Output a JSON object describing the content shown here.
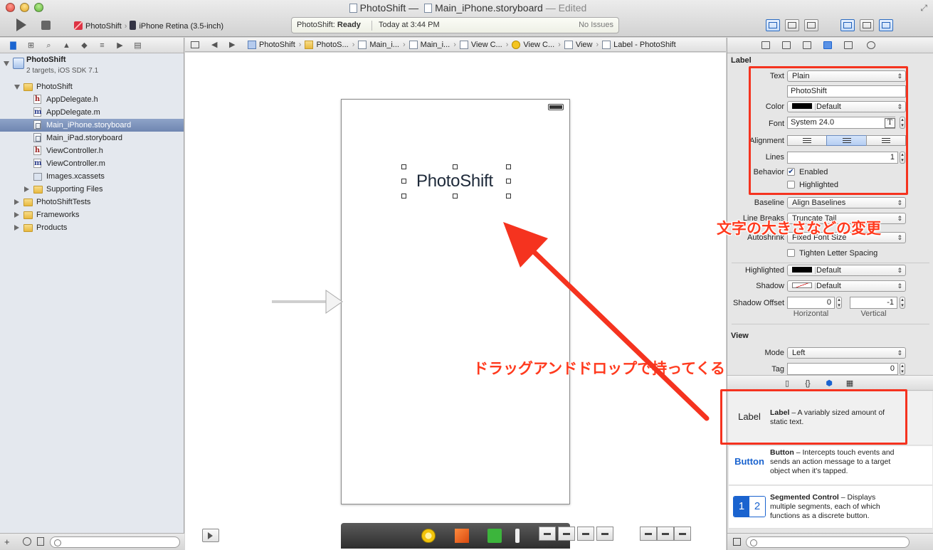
{
  "window": {
    "title": "PhotoShift",
    "doc_title": "Main_iPhone.storyboard",
    "edited": "— Edited",
    "separator": "—"
  },
  "toolbar": {
    "scheme": "PhotoShift",
    "device": "iPhone Retina (3.5-inch)",
    "status_app": "PhotoShift:",
    "status_state": "Ready",
    "status_time": "Today at 3:44 PM",
    "status_issues": "No Issues"
  },
  "navigator": {
    "project_name": "PhotoShift",
    "project_sub": "2 targets, iOS SDK 7.1",
    "items": [
      {
        "label": "PhotoShift",
        "type": "folder",
        "indent": 1,
        "disclosure": "open"
      },
      {
        "label": "AppDelegate.h",
        "type": "h",
        "indent": 2
      },
      {
        "label": "AppDelegate.m",
        "type": "m",
        "indent": 2
      },
      {
        "label": "Main_iPhone.storyboard",
        "type": "sb",
        "indent": 2,
        "selected": true
      },
      {
        "label": "Main_iPad.storyboard",
        "type": "sb",
        "indent": 2
      },
      {
        "label": "ViewController.h",
        "type": "h",
        "indent": 2
      },
      {
        "label": "ViewController.m",
        "type": "m",
        "indent": 2
      },
      {
        "label": "Images.xcassets",
        "type": "xc",
        "indent": 2
      },
      {
        "label": "Supporting Files",
        "type": "folder",
        "indent": 2,
        "disclosure": "closed"
      },
      {
        "label": "PhotoShiftTests",
        "type": "folder",
        "indent": 1,
        "disclosure": "closed"
      },
      {
        "label": "Frameworks",
        "type": "folder",
        "indent": 1,
        "disclosure": "closed"
      },
      {
        "label": "Products",
        "type": "folder",
        "indent": 1,
        "disclosure": "closed"
      }
    ]
  },
  "jumpbar": {
    "crumbs": [
      {
        "label": "PhotoShift",
        "icon": "proj"
      },
      {
        "label": "PhotoS...",
        "icon": "fold"
      },
      {
        "label": "Main_i...",
        "icon": "sb"
      },
      {
        "label": "Main_i...",
        "icon": "sb"
      },
      {
        "label": "View C...",
        "icon": "sb"
      },
      {
        "label": "View C...",
        "icon": "vc"
      },
      {
        "label": "View",
        "icon": "view"
      },
      {
        "label": "Label - PhotoShift",
        "icon": "view"
      }
    ]
  },
  "canvas": {
    "label_text": "PhotoShift"
  },
  "inspector": {
    "label_section": "Label",
    "text_label": "Text",
    "text_value": "Plain",
    "text_field": "PhotoShift",
    "color_label": "Color",
    "color_value": "Default",
    "font_label": "Font",
    "font_value": "System 24.0",
    "font_btn": "T",
    "alignment_label": "Alignment",
    "lines_label": "Lines",
    "lines_value": "1",
    "behavior_label": "Behavior",
    "enabled_label": "Enabled",
    "highlighted_check_label": "Highlighted",
    "baseline_label": "Baseline",
    "baseline_value": "Align Baselines",
    "linebreaks_label": "Line Breaks",
    "linebreaks_value": "Truncate Tail",
    "autoshrink_label": "Autoshrink",
    "autoshrink_value": "Fixed Font Size",
    "tighten_label": "Tighten Letter Spacing",
    "highlighted_label": "Highlighted",
    "highlighted_value": "Default",
    "shadow_label": "Shadow",
    "shadow_value": "Default",
    "shadow_offset_label": "Shadow Offset",
    "shadow_h": "0",
    "shadow_v": "-1",
    "horizontal_label": "Horizontal",
    "vertical_label": "Vertical",
    "view_section": "View",
    "mode_label": "Mode",
    "mode_value": "Left",
    "tag_label": "Tag",
    "tag_value": "0"
  },
  "library": {
    "items": [
      {
        "icon_text": "Label",
        "name": "Label",
        "desc": " – A variably sized amount of static text."
      },
      {
        "icon_text": "Button",
        "name": "Button",
        "desc": " – Intercepts touch events and sends an action message to a target object when it's tapped."
      },
      {
        "icon_text": "",
        "seg1": "1",
        "seg2": "2",
        "name": "Segmented Control",
        "desc": " – Displays multiple segments, each of which functions as a discrete button."
      }
    ]
  },
  "annotations": {
    "font_note": "文字の大きさなどの変更",
    "drag_note": "ドラッグアンドドロップで持ってくる",
    "color": "#f5331f"
  }
}
